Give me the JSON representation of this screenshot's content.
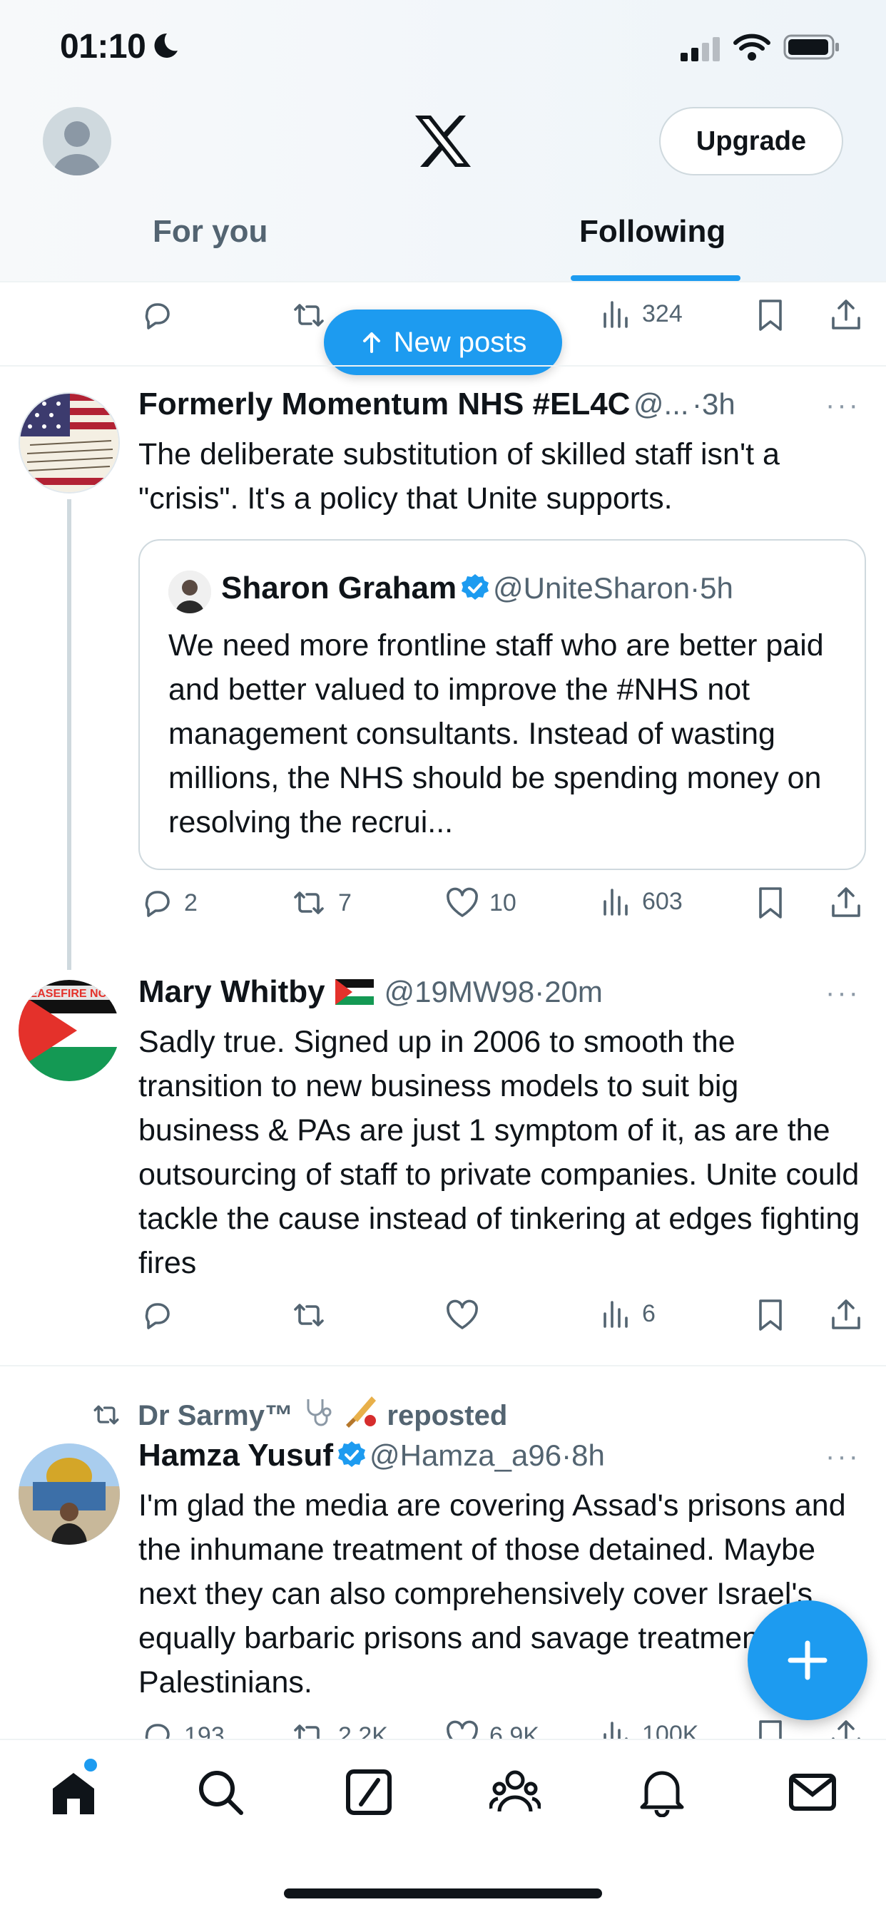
{
  "status_bar": {
    "time": "01:10"
  },
  "header": {
    "upgrade_label": "Upgrade"
  },
  "tabs": [
    {
      "label": "For you"
    },
    {
      "label": "Following"
    }
  ],
  "new_posts_label": "New posts",
  "first_row": {
    "views": "324"
  },
  "posts": [
    {
      "name": "Formerly Momentum NHS #EL4C",
      "handle": "@...",
      "time": "3h",
      "text": "The deliberate substitution of skilled staff isn't a \"crisis\". It's a policy that Unite supports.",
      "quote": {
        "name": "Sharon Graham",
        "handle": "@UniteSharon",
        "time": "5h",
        "text": "We need more frontline staff who are better paid and better valued to improve the #NHS not management consultants. Instead of wasting millions, the NHS should be spending money on resolving the recrui..."
      },
      "replies": "2",
      "reposts": "7",
      "likes": "10",
      "views": "603"
    },
    {
      "name": "Mary Whitby",
      "handle": "@19MW98",
      "time": "20m",
      "text": "Sadly true. Signed up in 2006 to smooth the transition to new business models to suit big business & PAs are just 1 symptom of it, as are the outsourcing of staff to private companies. Unite could tackle the cause instead of tinkering at edges fighting fires",
      "views": "6"
    },
    {
      "repost_label": "Dr Sarmy™",
      "repost_suffix": "reposted",
      "name": "Hamza Yusuf",
      "handle": "@Hamza_a96",
      "time": "8h",
      "text": "I'm glad the media are covering Assad's prisons and the inhumane treatment of those detained. Maybe next they can also comprehensively cover Israel's equally barbaric prisons and savage treatment of Palestinians.",
      "replies": "193",
      "reposts": "2.2K",
      "likes": "6.9K",
      "views": "100K"
    }
  ],
  "colors": {
    "accent": "#1d9bf0",
    "muted": "#536471",
    "divider": "#eff3f4"
  }
}
